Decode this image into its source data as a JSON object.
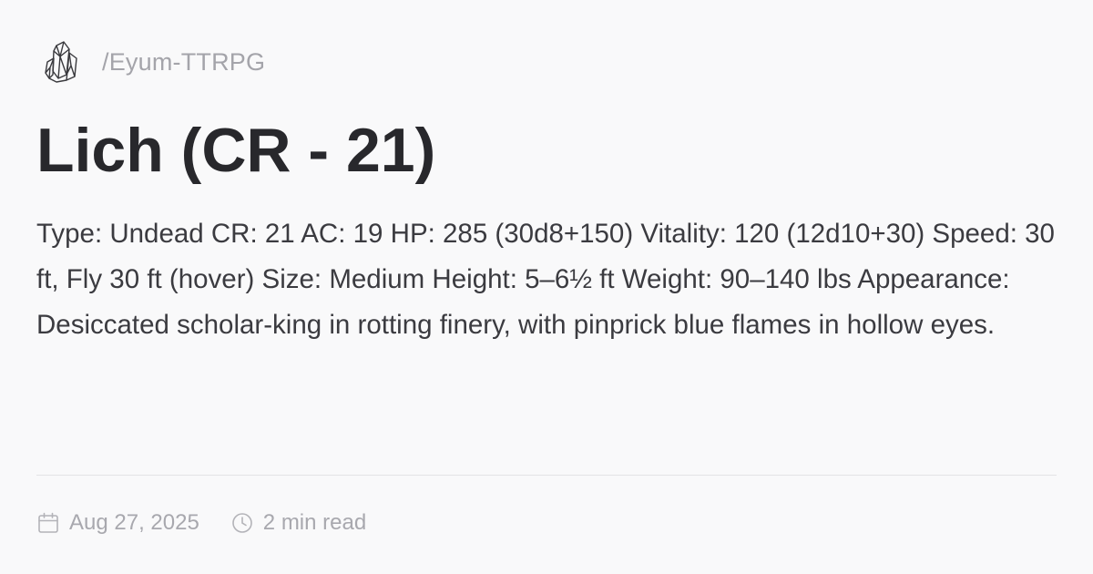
{
  "site": {
    "logo_icon": "crystal-cluster-icon",
    "name": "/Eyum-TTRPG"
  },
  "page": {
    "title": "Lich (CR - 21)",
    "description": "Type: Undead CR: 21 AC: 19 HP: 285 (30d8+150) Vitality: 120 (12d10+30) Speed: 30 ft, Fly 30 ft (hover) Size: Medium Height: 5–6½ ft Weight: 90–140 lbs Appearance: Desiccated scholar-king in rotting finery, with pinprick blue flames in hollow eyes."
  },
  "meta": {
    "date_icon": "calendar-icon",
    "date": "Aug 27, 2025",
    "read_icon": "clock-icon",
    "read_time": "2 min read"
  },
  "colors": {
    "background": "#f9f9fa",
    "title": "#28282c",
    "body_text": "#3b3b40",
    "muted": "#a8a8ae",
    "divider": "#e3e3e6"
  }
}
